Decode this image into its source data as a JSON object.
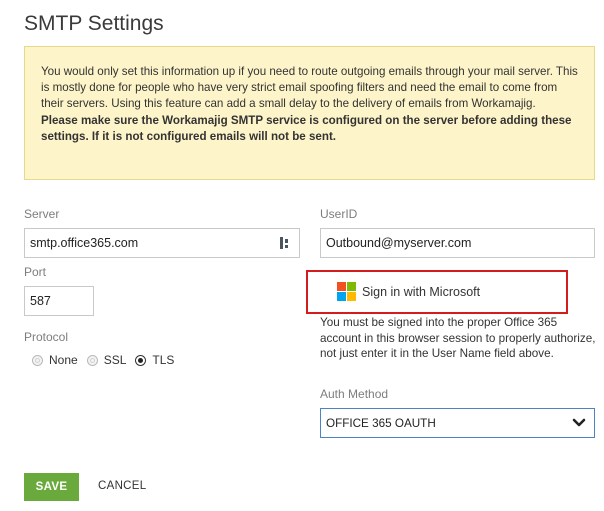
{
  "page": {
    "title": "SMTP Settings"
  },
  "notice": {
    "text": "You would only set this information up if you need to route outgoing emails through your mail server. This is mostly done for people who have very strict email spoofing filters and need the email to come from their servers. Using this feature can add a small delay to the delivery of emails from Workamajig.",
    "warning": "Please make sure the Workamajig SMTP service is configured on the server before adding these settings. If it is not configured emails will not be sent."
  },
  "form": {
    "server_label": "Server",
    "server_value": "smtp.office365.com",
    "port_label": "Port",
    "port_value": "587",
    "protocol_label": "Protocol",
    "protocol_options": [
      "None",
      "SSL",
      "TLS"
    ],
    "protocol_selected": "TLS",
    "userid_label": "UserID",
    "userid_value": "Outbound@myserver.com",
    "ms_signin_label": "Sign in with Microsoft",
    "help_text": "You must be signed into the proper Office 365 account in this browser session to properly authorize, not just enter it in the User Name field above.",
    "auth_label": "Auth Method",
    "auth_value": "OFFICE 365 OAUTH"
  },
  "actions": {
    "save_label": "SAVE",
    "cancel_label": "CANCEL"
  },
  "colors": {
    "notice_bg": "#fdf4c9",
    "save_green": "#6aaa3c",
    "highlight_red": "#d31c1c",
    "ms_red": "#f25022",
    "ms_green": "#7fba00",
    "ms_blue": "#00a4ef",
    "ms_yellow": "#ffb900"
  },
  "icons": {
    "password_manager": "key-icon",
    "dropdown": "chevron-down-icon",
    "microsoft": "microsoft-logo-icon"
  }
}
